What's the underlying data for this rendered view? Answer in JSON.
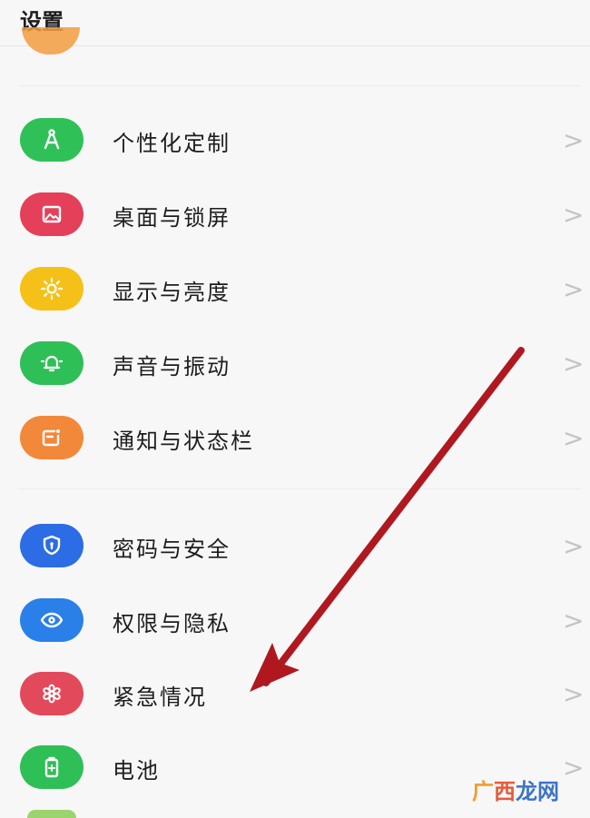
{
  "header": {
    "title": "设置"
  },
  "colors": {
    "personalize": "#2fc157",
    "desktop": "#e4405a",
    "display": "#f5c118",
    "sound": "#2fbf57",
    "notify": "#f2883a",
    "password": "#2c6ce4",
    "privacy": "#2a7fe8",
    "emergency": "#e24a5c",
    "battery": "#2fbf57",
    "arrow": "#b01820"
  },
  "settings": {
    "items": [
      {
        "label": "个性化定制",
        "icon": "compass-icon"
      },
      {
        "label": "桌面与锁屏",
        "icon": "image-icon"
      },
      {
        "label": "显示与亮度",
        "icon": "sun-icon"
      },
      {
        "label": "声音与振动",
        "icon": "bell-icon"
      },
      {
        "label": "通知与状态栏",
        "icon": "notification-icon"
      },
      {
        "label": "密码与安全",
        "icon": "shield-icon"
      },
      {
        "label": "权限与隐私",
        "icon": "eye-icon"
      },
      {
        "label": "紧急情况",
        "icon": "flower-icon"
      },
      {
        "label": "电池",
        "icon": "battery-icon"
      }
    ],
    "chevron": ">"
  },
  "watermark": {
    "part1": "广",
    "part2": "西",
    "part3": "龙网"
  }
}
